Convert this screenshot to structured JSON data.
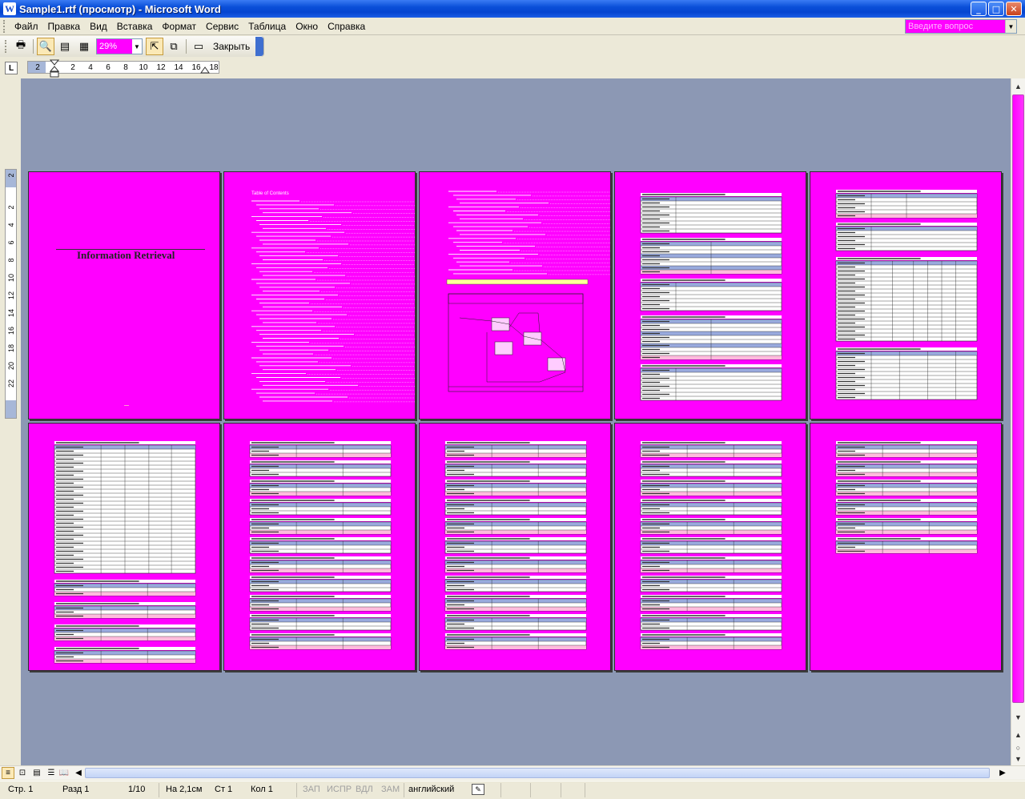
{
  "window": {
    "title": "Sample1.rtf (просмотр) - Microsoft Word",
    "app_icon": "W"
  },
  "menu": {
    "items": [
      "Файл",
      "Правка",
      "Вид",
      "Вставка",
      "Формат",
      "Сервис",
      "Таблица",
      "Окно",
      "Справка"
    ],
    "help_placeholder": "Введите вопрос"
  },
  "toolbar": {
    "zoom": "29%",
    "close_label": "Закрыть"
  },
  "ruler": {
    "corner": "L",
    "h_ticks": [
      "2",
      "2",
      "4",
      "6",
      "8",
      "10",
      "12",
      "14",
      "16",
      "18"
    ],
    "v_ticks": [
      "2",
      "2",
      "4",
      "6",
      "8",
      "10",
      "12",
      "14",
      "16",
      "18",
      "20",
      "22"
    ]
  },
  "document": {
    "pages": [
      {
        "index": 1,
        "kind": "title",
        "heading": "Information Retrieval"
      },
      {
        "index": 2,
        "kind": "toc",
        "heading": "Table of Contents"
      },
      {
        "index": 3,
        "kind": "toc-diagram"
      },
      {
        "index": 4,
        "kind": "tables"
      },
      {
        "index": 5,
        "kind": "tables"
      },
      {
        "index": 6,
        "kind": "grid"
      },
      {
        "index": 7,
        "kind": "tables"
      },
      {
        "index": 8,
        "kind": "tables"
      },
      {
        "index": 9,
        "kind": "tables"
      },
      {
        "index": 10,
        "kind": "tables-short"
      }
    ],
    "page_color": "#ff00ff",
    "background_color": "#8c98b4"
  },
  "status": {
    "page": "Стр. 1",
    "section": "Разд 1",
    "pages": "1/10",
    "at": "На 2,1см",
    "line": "Ст 1",
    "col": "Кол 1",
    "rec": "ЗАП",
    "trk": "ИСПР",
    "ext": "ВДЛ",
    "ovr": "ЗАМ",
    "language": "английский"
  }
}
